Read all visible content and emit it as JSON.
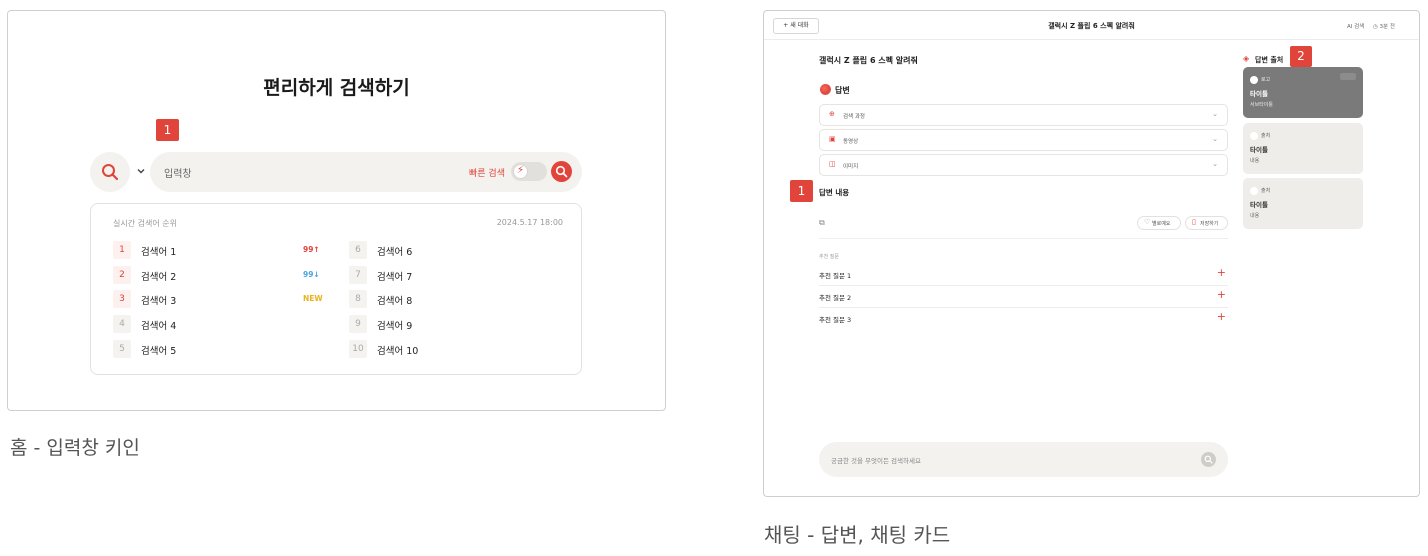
{
  "home": {
    "title": "편리하게 검색하기",
    "marker": "1",
    "search_placeholder": "입력창",
    "quick_search_label": "빠른 검색",
    "toggle_glyph": "⚡",
    "ranking": {
      "title": "실시간 검색어 순위",
      "timestamp": "2024.5.17 18:00",
      "left": [
        {
          "rank": "1",
          "term": "검색어 1",
          "delta": "99↑",
          "delta_color": "#e0443a"
        },
        {
          "rank": "2",
          "term": "검색어 2",
          "delta": "99↓",
          "delta_color": "#4da3e0"
        },
        {
          "rank": "3",
          "term": "검색어 3",
          "delta": "NEW",
          "delta_color": "#e8b223"
        },
        {
          "rank": "4",
          "term": "검색어 4",
          "delta": "",
          "delta_color": "#999999"
        },
        {
          "rank": "5",
          "term": "검색어 5",
          "delta": "",
          "delta_color": "#999999"
        }
      ],
      "right": [
        {
          "rank": "6",
          "term": "검색어 6"
        },
        {
          "rank": "7",
          "term": "검색어 7"
        },
        {
          "rank": "8",
          "term": "검색어 8"
        },
        {
          "rank": "9",
          "term": "검색어 9"
        },
        {
          "rank": "10",
          "term": "검색어 10"
        }
      ]
    },
    "caption": "홈 - 입력창 키인"
  },
  "chat": {
    "new_chat_label": "+ 새 대화",
    "title": "갤럭시 Z 플립 6 스펙 알려줘",
    "ai_search_label": "AI 검색",
    "history_label": "◷ 3분 전",
    "question": "갤럭시 Z 플립 6 스펙 알려줘",
    "answer_label": "답변",
    "accordions": [
      {
        "icon": "⊕",
        "label": "검색 과정",
        "chevron": "⌄"
      },
      {
        "icon": "▣",
        "label": "동영상",
        "chevron": "⌄"
      },
      {
        "icon": "◫",
        "label": "이미지",
        "chevron": "⌄"
      }
    ],
    "marker1": "1",
    "answer_content": "답변 내용",
    "copy_glyph": "⧉",
    "feedback_icon": "♡",
    "feedback_label": "별로예요",
    "save_icon": "▯",
    "save_label": "저장하기",
    "recommend_title": "추천 질문",
    "recommendations": [
      {
        "text": "추천 질문 1",
        "plus": "+"
      },
      {
        "text": "추천 질문 2",
        "plus": "+"
      },
      {
        "text": "추천 질문 3",
        "plus": "+"
      }
    ],
    "input_placeholder": "궁금한 것을 무엇이든 검색하세요",
    "sources_icon": "◈",
    "sources_label": "답변 출처",
    "marker2": "2",
    "source_cards": [
      {
        "kind": "로고",
        "title": "타이틀",
        "sub": "서브타이틀",
        "active": true
      },
      {
        "kind": "출처",
        "title": "타이틀",
        "sub": "내용",
        "active": false
      },
      {
        "kind": "출처",
        "title": "타이틀",
        "sub": "내용",
        "active": false
      }
    ],
    "caption": "채팅 - 답변, 채팅 카드"
  },
  "colors": {
    "accent": "#e0443a",
    "down": "#4da3e0",
    "new": "#e8b223",
    "surface": "#f3f2ef"
  }
}
